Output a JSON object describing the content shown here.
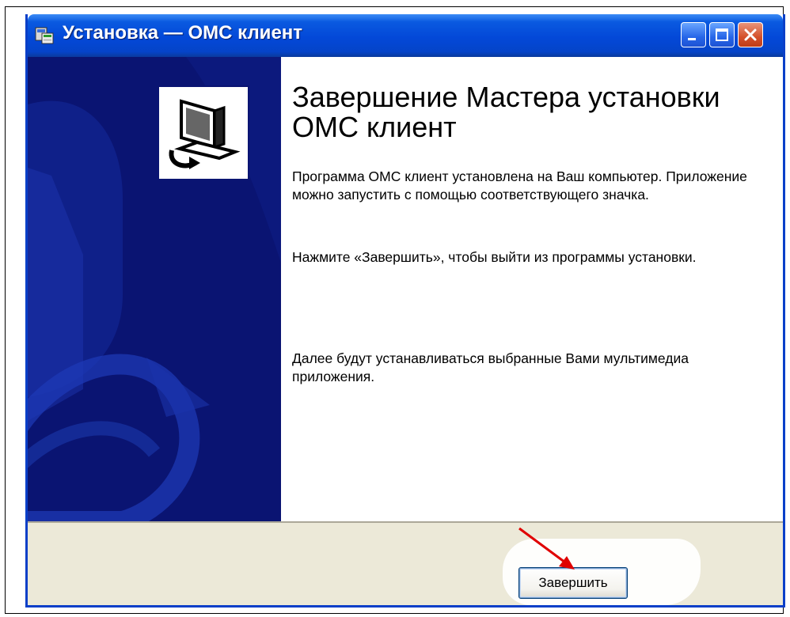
{
  "window": {
    "title": "Установка — ОМС клиент",
    "controls": [
      "minimize-icon",
      "maximize-icon",
      "close-icon"
    ]
  },
  "content": {
    "heading": "Завершение Мастера установки ОМС клиент",
    "paragraph_installed": "Программа ОМС клиент установлена на Ваш компьютер. Приложение можно запустить с помощью соответствующего значка.",
    "paragraph_finish_hint": "Нажмите «Завершить», чтобы выйти из программы установки.",
    "paragraph_next": "Далее будут устанавливаться выбранные Вами мультимедиа приложения."
  },
  "footer": {
    "finish_label": "Завершить"
  },
  "colors": {
    "titlebar": "#0348d8",
    "sidebar": "#0a1472",
    "footer": "#ece9d8",
    "annotation_arrow": "#e00000"
  }
}
